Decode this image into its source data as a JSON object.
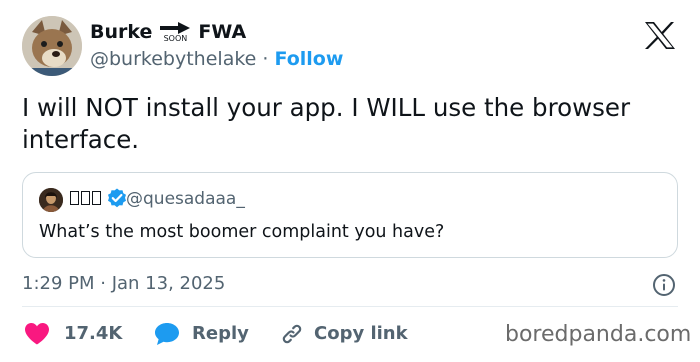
{
  "tweet": {
    "author": {
      "name_left": "Burke",
      "name_soon": "SOON",
      "name_right": "FWA",
      "handle": "@burkebythelake",
      "separator": "·",
      "follow_label": "Follow"
    },
    "text": "I will NOT install your app. I WILL use the browser interface.",
    "quoted": {
      "handle": "@quesadaaa_",
      "text": "What’s the most boomer complaint you have?"
    },
    "timestamp": "1:29 PM · Jan 13, 2025",
    "actions": {
      "likes": "17.4K",
      "reply_label": "Reply",
      "copy_link_label": "Copy link"
    }
  },
  "watermark": "boredpanda.com",
  "colors": {
    "accent": "#1d9bf0",
    "like": "#f91880",
    "text": "#0f1419",
    "muted": "#536471"
  },
  "icons": {
    "brand": "x-logo-icon",
    "verified": "verified-badge-icon",
    "info": "info-icon",
    "like": "heart-icon",
    "reply": "speech-bubble-icon",
    "copy": "link-icon"
  }
}
